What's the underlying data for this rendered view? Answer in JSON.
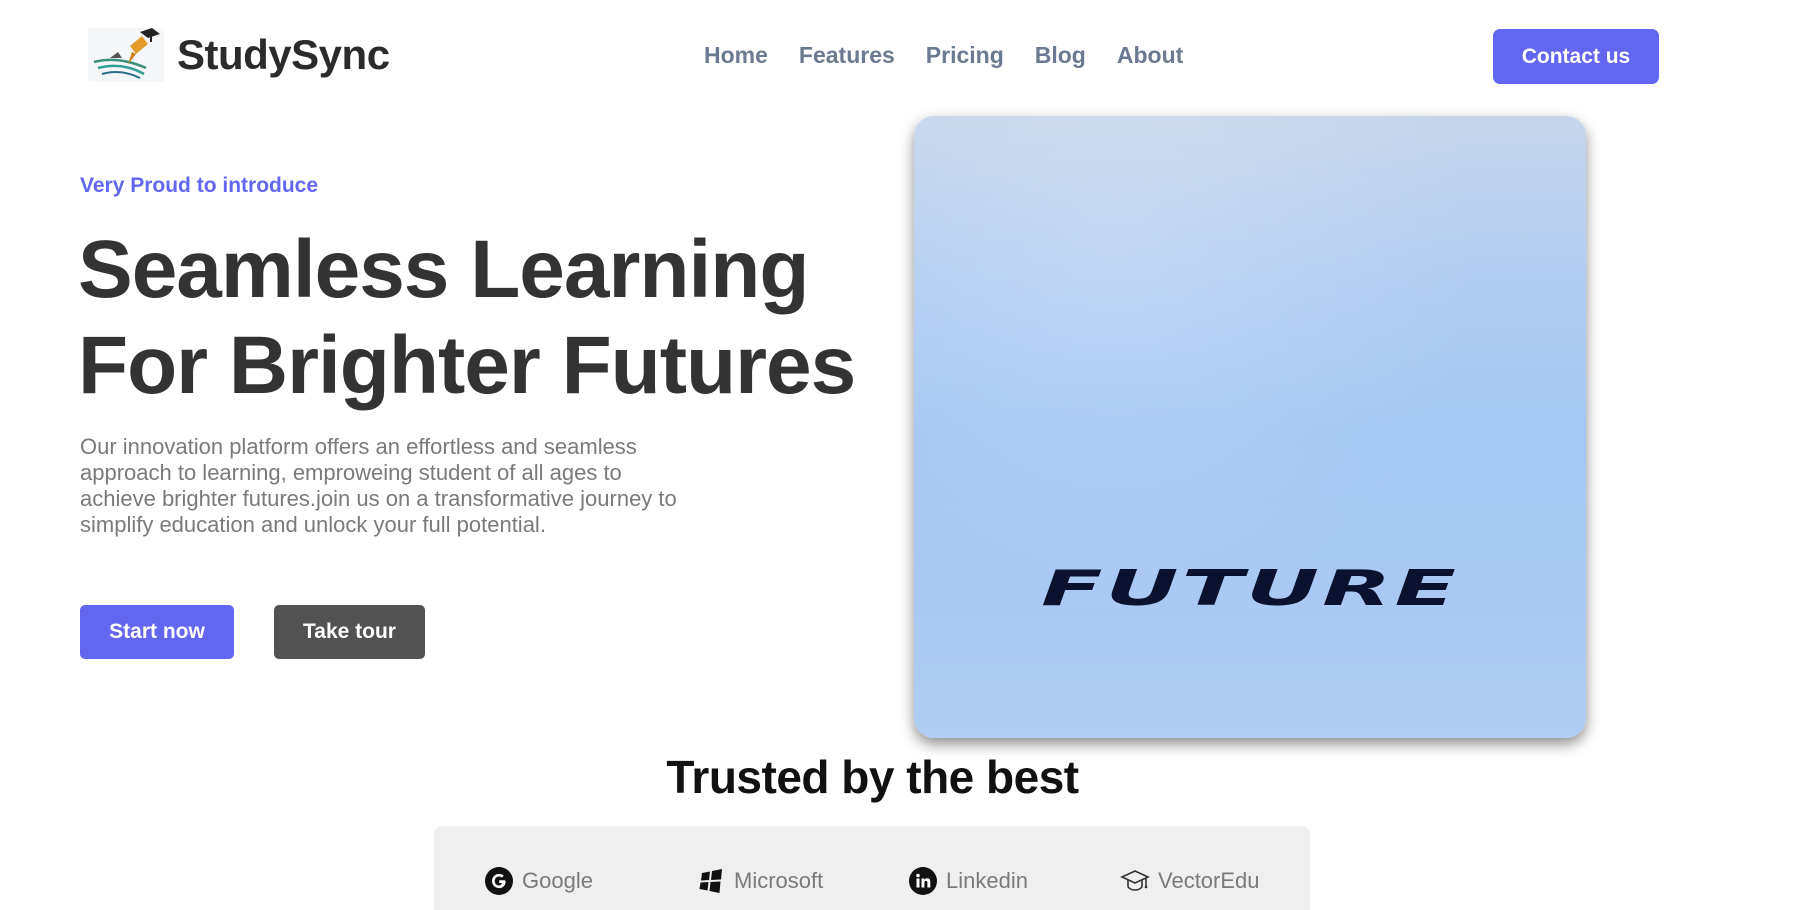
{
  "brand": {
    "name": "StudySync"
  },
  "nav": {
    "items": [
      {
        "label": "Home"
      },
      {
        "label": "Features"
      },
      {
        "label": "Pricing"
      },
      {
        "label": "Blog"
      },
      {
        "label": "About"
      }
    ],
    "contact_label": "Contact us"
  },
  "hero": {
    "eyebrow": "Very Proud to introduce",
    "title_line1": "Seamless Learning",
    "title_line2": "For Brighter Futures",
    "description": "Our innovation platform offers an effortless and seamless approach to learning, emproweing student of all ages to achieve brighter futures.join us on a transformative journey to simplify education and unlock your full potential.",
    "start_label": "Start now",
    "tour_label": "Take tour",
    "image_word": "FUTURE"
  },
  "trusted": {
    "title": "Trusted by the best",
    "partners": [
      {
        "name": "Google",
        "icon": "google-icon"
      },
      {
        "name": "Microsoft",
        "icon": "windows-icon"
      },
      {
        "name": "Linkedin",
        "icon": "linkedin-icon"
      },
      {
        "name": "VectorEdu",
        "icon": "graduation-cap-icon"
      }
    ]
  },
  "colors": {
    "accent": "#6366f1",
    "secondary_button": "#525252",
    "nav_text": "#6b7a90",
    "heading": "#333333"
  }
}
